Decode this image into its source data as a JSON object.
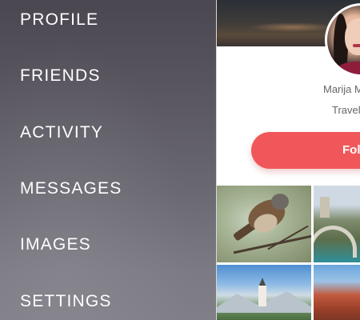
{
  "menu": {
    "items": [
      {
        "id": "profile",
        "label": "PROFILE"
      },
      {
        "id": "friends",
        "label": "FRIENDS"
      },
      {
        "id": "activity",
        "label": "ACTIVITY"
      },
      {
        "id": "messages",
        "label": "MESSAGES"
      },
      {
        "id": "images",
        "label": "IMAGES"
      },
      {
        "id": "settings",
        "label": "SETTINGS"
      }
    ]
  },
  "profile": {
    "name": "Marija M",
    "role": "Travel",
    "follow_label": "Fol"
  },
  "colors": {
    "accent": "#f0575a",
    "menu_bg": "#5a5761",
    "menu_text": "#ffffff",
    "muted_text": "#666666"
  },
  "gallery": {
    "images": [
      {
        "id": "sparrow-photo",
        "icon": "bird"
      },
      {
        "id": "bridge-photo",
        "icon": "bridge"
      },
      {
        "id": "church-photo",
        "icon": "church"
      },
      {
        "id": "rooftops-photo",
        "icon": "rooftops"
      }
    ]
  }
}
